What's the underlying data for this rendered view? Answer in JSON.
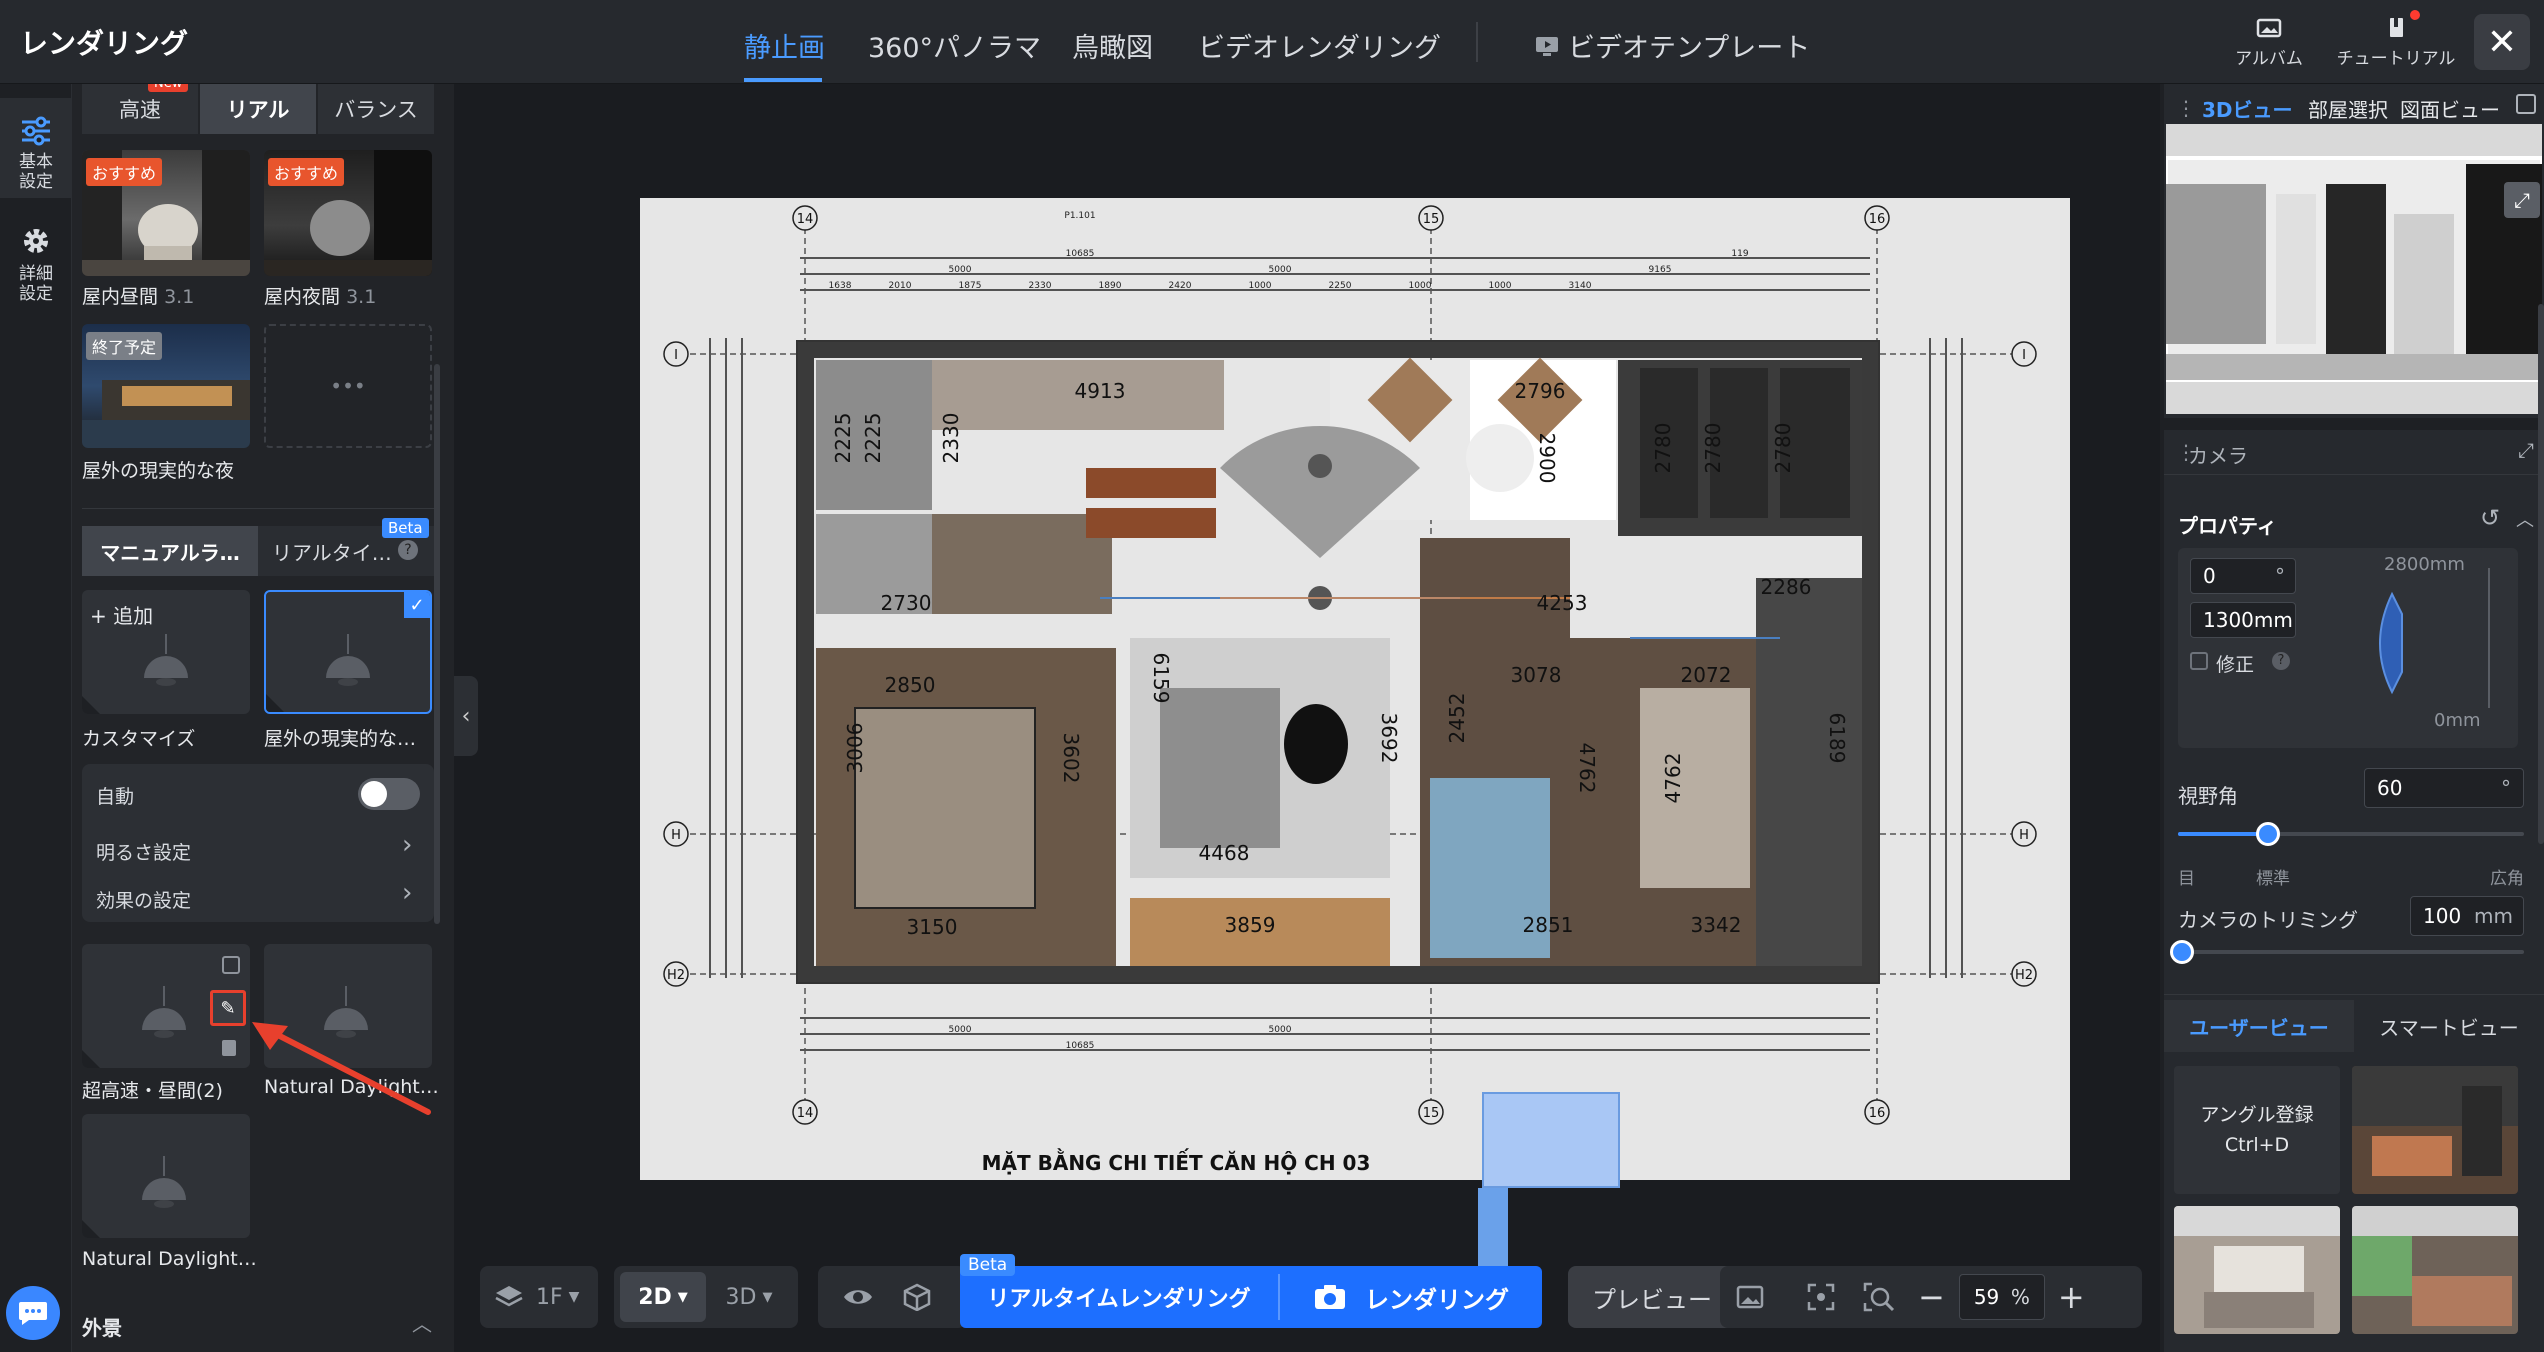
{
  "app": {
    "title": "レンダリング"
  },
  "tabs": [
    {
      "label": "静止画",
      "active": true
    },
    {
      "label": "360°パノラマ"
    },
    {
      "label": "鳥瞰図"
    },
    {
      "label": "ビデオレンダリング"
    },
    {
      "label": "ビデオテンプレート"
    }
  ],
  "top_right": {
    "album": "アルバム",
    "tutorial": "チュートリアル"
  },
  "rail": {
    "basic": "基本設定",
    "detail": "詳細設定"
  },
  "left": {
    "quality_tabs": [
      "高速",
      "リアル",
      "バランス"
    ],
    "quality_active": "リアル",
    "new_badge": "New",
    "presets": [
      {
        "name": "屋内昼間",
        "version": "3.1",
        "badge": "おすすめ"
      },
      {
        "name": "屋内夜間",
        "version": "3.1",
        "badge": "おすすめ"
      },
      {
        "name": "屋外の現実的な夜",
        "badge": "終了予定"
      }
    ],
    "more": "•••",
    "light_tabs": [
      "マニュアルラ…",
      "リアルタイ…"
    ],
    "beta": "Beta",
    "help": "?",
    "add_label": "+ 追加",
    "light_cards": [
      {
        "name": "カスタマイズ"
      },
      {
        "name": "屋外の現実的な…",
        "selected": true
      }
    ],
    "auto_label": "自動",
    "auto_on": false,
    "brightness": "明るさ設定",
    "effects": "効果の設定",
    "saved_cards": [
      {
        "name": "超高速・昼間(2)"
      },
      {
        "name": "Natural Daylight…"
      },
      {
        "name": "Natural Daylight…"
      }
    ],
    "exterior": "外景"
  },
  "plan": {
    "title": "MẶT BẰNG CHI TIẾT CĂN HỘ CH 03",
    "grid_cols": [
      "14",
      "15",
      "16"
    ],
    "grid_rows": [
      "I",
      "H",
      "H2"
    ],
    "dims": [
      "4913",
      "2225",
      "2225",
      "2330",
      "2796",
      "2900",
      "2780",
      "2780",
      "2780",
      "2730",
      "4253",
      "2286",
      "2850",
      "3006",
      "3602",
      "6159",
      "3692",
      "4468",
      "3078",
      "2452",
      "4762",
      "2072",
      "4762",
      "6189",
      "3150",
      "3859",
      "2851",
      "3342"
    ],
    "top_labels": [
      "P1.101",
      "10685",
      "5000",
      "5000",
      "1638",
      "2010",
      "1875",
      "2330",
      "1890",
      "2420",
      "1000",
      "2250",
      "1000",
      "1000",
      "3140",
      "9165",
      "119"
    ],
    "bottom_labels": [
      "10685",
      "5000",
      "5000"
    ]
  },
  "bottom": {
    "floor": "1F",
    "mode_2d": "2D",
    "mode_3d": "3D",
    "beta": "Beta",
    "realtime": "リアルタイムレンダリング",
    "render": "レンダリング",
    "preview": "プレビュー",
    "zoom": "59",
    "percent": "%"
  },
  "right": {
    "view_tabs": [
      "3Dビュー",
      "部屋選択",
      "図面ビュー"
    ],
    "camera_title": "カメラ",
    "properties": "プロパティ",
    "rotation": "0",
    "deg": "°",
    "height": "1300mm",
    "fix": "修正",
    "max_height": "2800mm",
    "min_height": "0mm",
    "fov_label": "視野角",
    "fov_value": "60",
    "fov_unit": "°",
    "fov_fraction": 0.26,
    "fov_marks": [
      "目",
      "標準",
      "広角"
    ],
    "trim_label": "カメラのトリミング",
    "trim_value": "100",
    "trim_unit": "mm",
    "view_tabs2": [
      "ユーザービュー",
      "スマートビュー"
    ],
    "angle_register": "アングル登録",
    "shortcut": "Ctrl+D"
  },
  "colors": {
    "accent": "#4a9bff",
    "render_blue": "#1d6fff",
    "badge_orange": "#e8552d"
  }
}
